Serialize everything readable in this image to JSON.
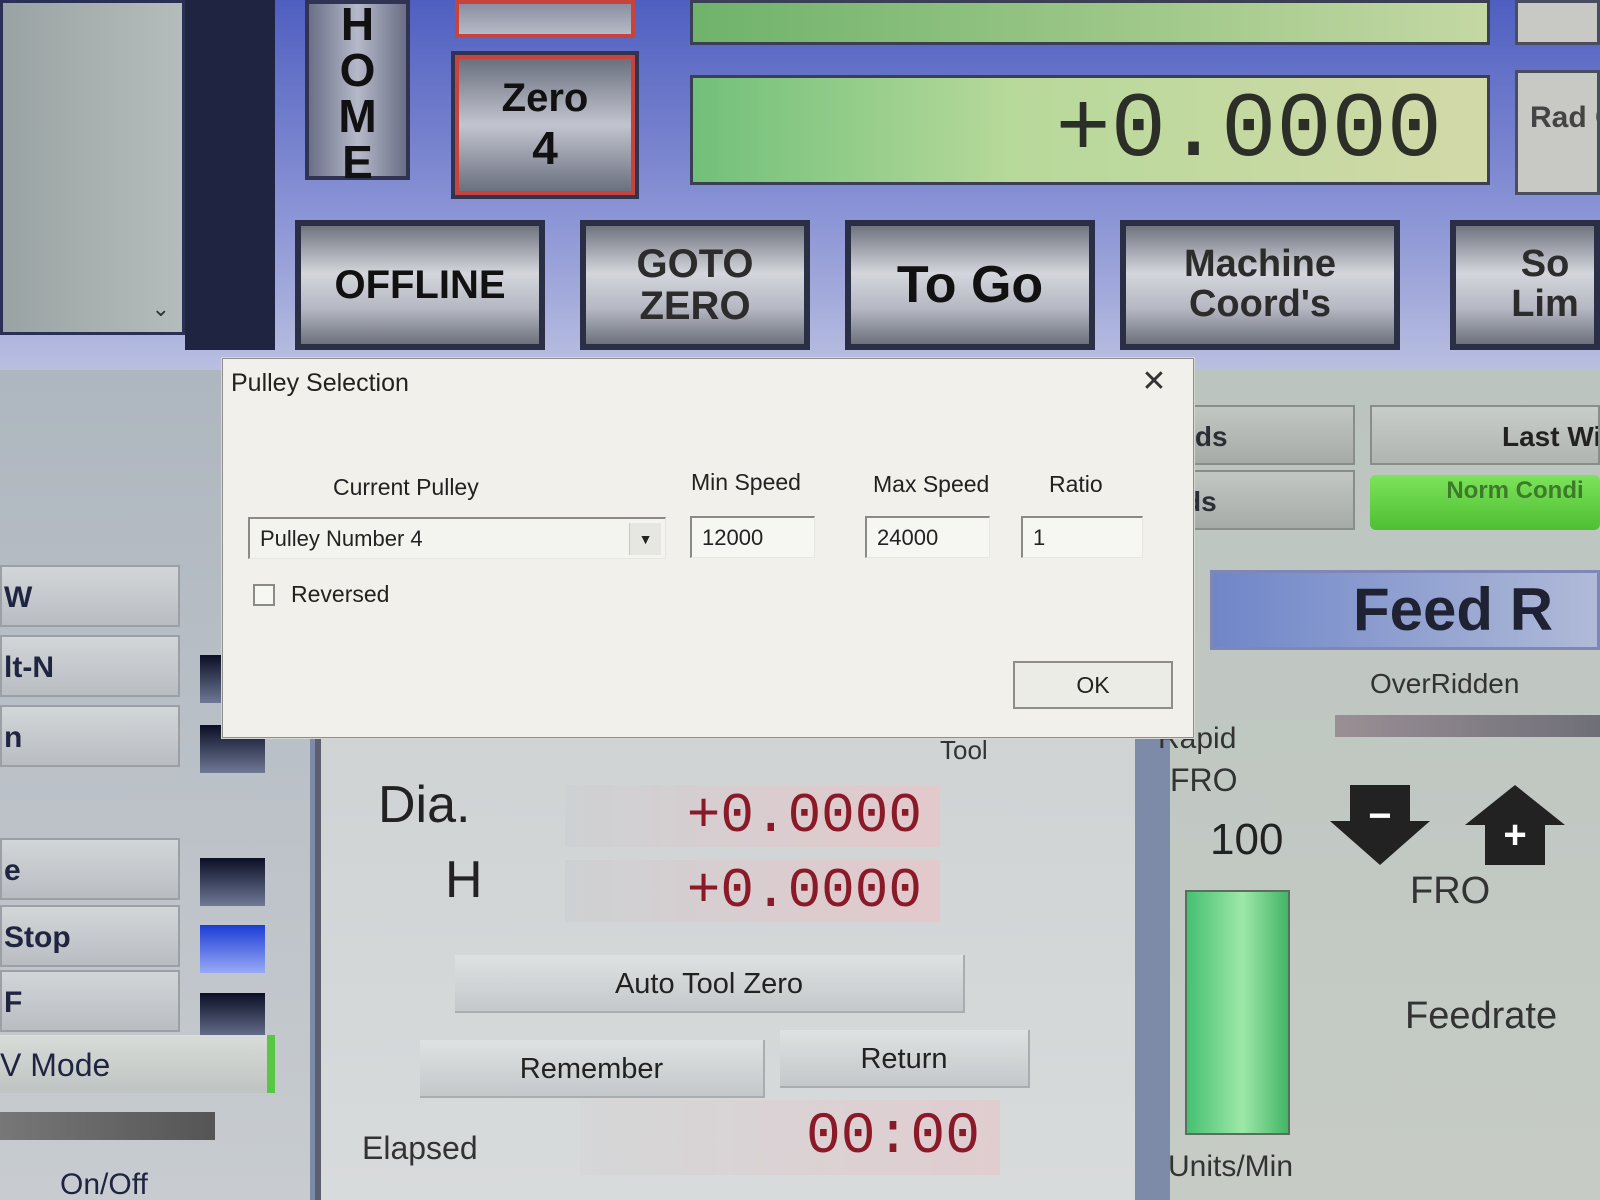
{
  "mach": {
    "home_label": "HOME",
    "zero_label_1": "Zero",
    "zero_label_2": "4",
    "dro_value": "+0.0000",
    "rad_text": "Rad Con",
    "buttons": {
      "offline": "OFFLINE",
      "goto_zero": "GOTO ZERO",
      "to_go": "To Go",
      "machine_coords": "Machine Coord's",
      "soft_limits": "So Lim"
    },
    "coords_1": "rds",
    "coords_2": "ds",
    "last_wizard": "Last Wi",
    "normal_condition": "Norm Condi",
    "feed_rate_title": "Feed R",
    "overridden": "OverRidden",
    "rapid": "Rapid",
    "fro_left": "FRO",
    "fro_value": "100",
    "units_min": "Units/Min",
    "fro_right": "FRO",
    "feedrate": "Feedrate",
    "fro_down_symbol": "−",
    "fro_up_symbol": "+",
    "left_items": [
      "W",
      "lt-N",
      "n",
      "e",
      "Stop",
      "F"
    ],
    "v_mode": "V Mode",
    "on_off": "On/Off",
    "tool_label": "Tool",
    "dia_label": "Dia.",
    "dia_value": "+0.0000",
    "h_label": "H",
    "h_value": "+0.0000",
    "auto_tool_zero": "Auto Tool Zero",
    "remember": "Remember",
    "return": "Return",
    "elapsed_label": "Elapsed",
    "elapsed_value": "00:00"
  },
  "dialog": {
    "title": "Pulley Selection",
    "current_pulley_label": "Current Pulley",
    "current_pulley_value": "Pulley Number 4",
    "min_speed_label": "Min Speed",
    "min_speed_value": "12000",
    "max_speed_label": "Max Speed",
    "max_speed_value": "24000",
    "ratio_label": "Ratio",
    "ratio_value": "1",
    "reversed_label": "Reversed",
    "reversed_checked": false,
    "ok_label": "OK"
  }
}
